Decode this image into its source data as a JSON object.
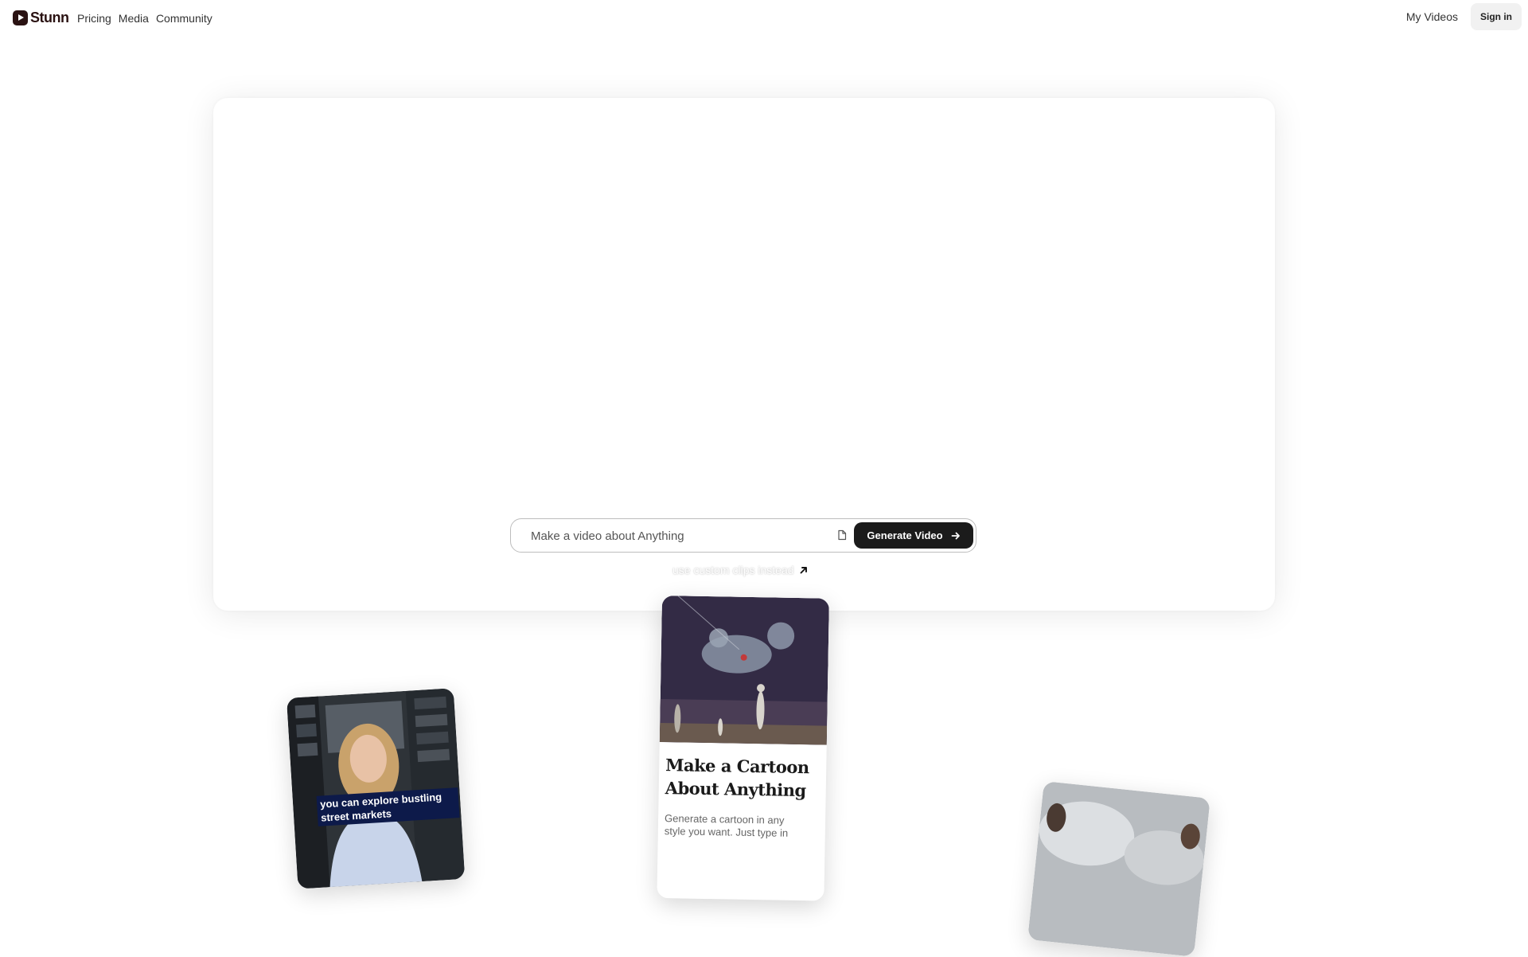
{
  "nav": {
    "brand": "Stunn",
    "links": [
      "Pricing",
      "Media",
      "Community"
    ],
    "my_videos": "My Videos",
    "sign_in": "Sign in"
  },
  "prompt": {
    "placeholder": "Make a video about Anything",
    "generate_label": "Generate Video",
    "custom_clips": "use custom clips instead"
  },
  "cards": {
    "left": {
      "caption": "you can explore bustling street markets"
    },
    "center": {
      "title": "Make a Cartoon About Anything",
      "description": "Generate a cartoon in any style you want. Just type in"
    }
  },
  "colors": {
    "brand": "#2a1212",
    "button_dark": "#1b1b1b",
    "sign_in_bg": "#f1f1f1",
    "caption_bg": "#0d1a4a"
  }
}
